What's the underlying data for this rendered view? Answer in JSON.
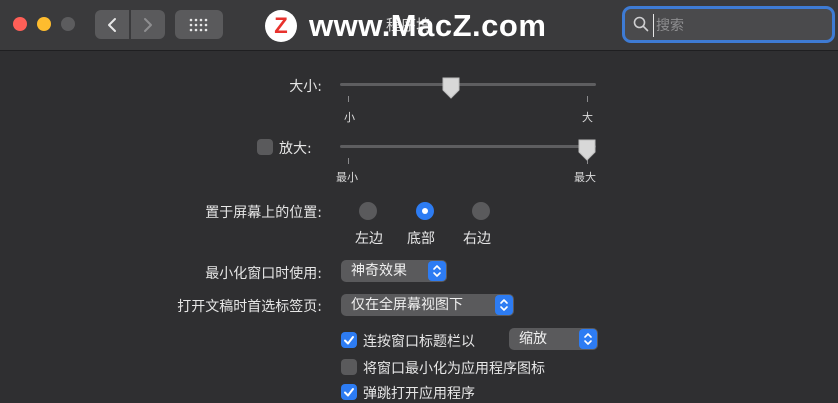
{
  "window": {
    "title": "程序坞",
    "search_placeholder": "搜索"
  },
  "watermark": {
    "text": "www.MacZ.com",
    "logo_letter": "Z"
  },
  "size": {
    "label": "大小:",
    "min_label": "小",
    "max_label": "大",
    "value": 0.43
  },
  "magnify": {
    "label": "放大:",
    "checked": false,
    "min_label": "最小",
    "max_label": "最大",
    "value": 1.0
  },
  "position": {
    "label": "置于屏幕上的位置:",
    "options": [
      "左边",
      "底部",
      "右边"
    ],
    "selected": "底部"
  },
  "minimize_using": {
    "label": "最小化窗口时使用:",
    "value": "神奇效果"
  },
  "prefer_tabs": {
    "label": "打开文稿时首选标签页:",
    "value": "仅在全屏幕视图下"
  },
  "checks": {
    "double_click": {
      "label": "连按窗口标题栏以",
      "checked": true,
      "value": "缩放"
    },
    "minimize_into_icon": {
      "label": "将窗口最小化为应用程序图标",
      "checked": false
    },
    "animate": {
      "label": "弹跳打开应用程序",
      "checked": true
    }
  },
  "colors": {
    "accent": "#2d7cf3",
    "background": "#2f2f31",
    "titlebar": "#3a3a3c"
  }
}
